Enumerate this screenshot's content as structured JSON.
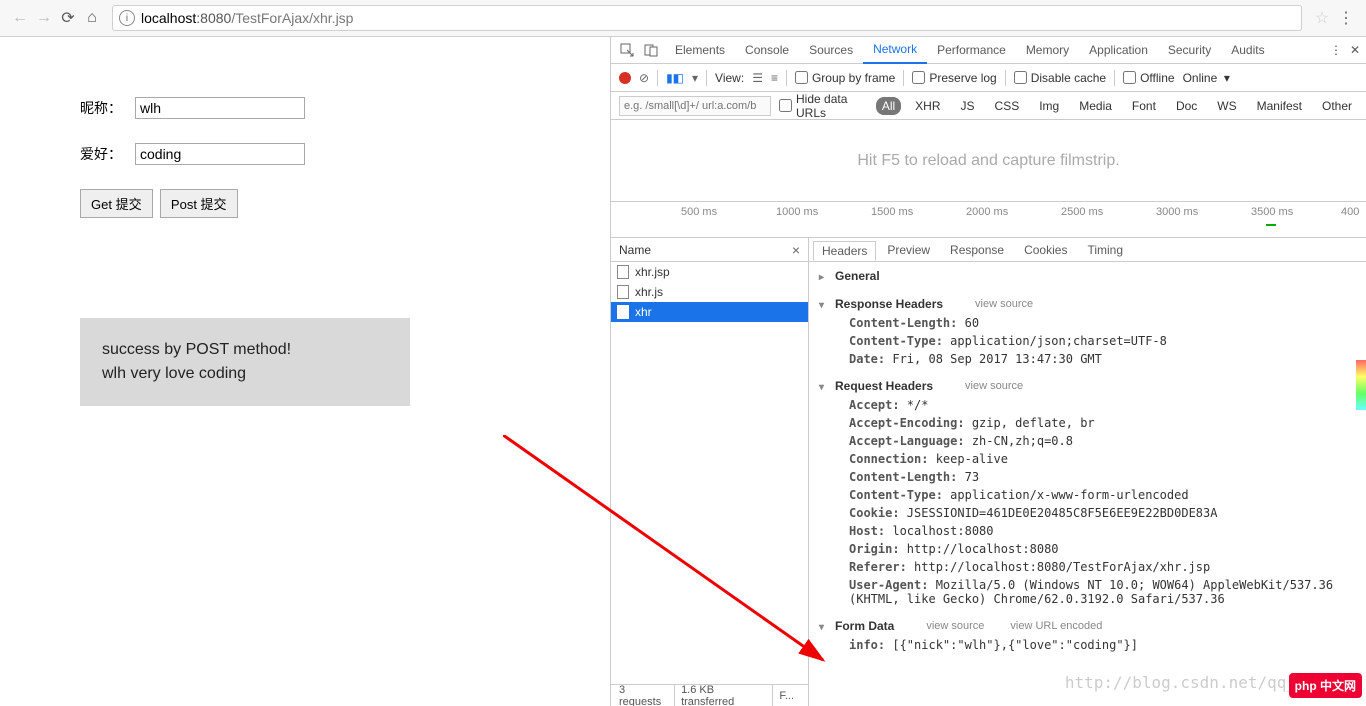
{
  "browser": {
    "url_host": "localhost",
    "url_port": ":8080",
    "url_path": "/TestForAjax/xhr.jsp"
  },
  "page": {
    "nick_label": "昵称：",
    "nick_value": "wlh",
    "hobby_label": "爱好：",
    "hobby_value": "coding",
    "get_btn": "Get 提交",
    "post_btn": "Post 提交",
    "result_line1": "success by POST method!",
    "result_line2": "wlh very love coding"
  },
  "devtools": {
    "tabs": [
      "Elements",
      "Console",
      "Sources",
      "Network",
      "Performance",
      "Memory",
      "Application",
      "Security",
      "Audits"
    ],
    "active_tab": "Network",
    "toolbar": {
      "view_label": "View:",
      "group_by_frame": "Group by frame",
      "preserve_log": "Preserve log",
      "disable_cache": "Disable cache",
      "offline": "Offline",
      "online": "Online"
    },
    "filter": {
      "placeholder": "e.g. /small[\\d]+/ url:a.com/b",
      "hide_data_urls": "Hide data URLs",
      "types": [
        "All",
        "XHR",
        "JS",
        "CSS",
        "Img",
        "Media",
        "Font",
        "Doc",
        "WS",
        "Manifest",
        "Other"
      ],
      "active_type": "All"
    },
    "filmstrip_hint": "Hit F5 to reload and capture filmstrip.",
    "timeline_ticks": [
      "500 ms",
      "1000 ms",
      "1500 ms",
      "2000 ms",
      "2500 ms",
      "3000 ms",
      "3500 ms",
      "400"
    ],
    "reqlist": {
      "header": "Name",
      "items": [
        "xhr.jsp",
        "xhr.js",
        "xhr"
      ],
      "selected": "xhr"
    },
    "details": {
      "tabs": [
        "Headers",
        "Preview",
        "Response",
        "Cookies",
        "Timing"
      ],
      "active": "Headers",
      "sections": {
        "general": "General",
        "response_headers": "Response Headers",
        "request_headers": "Request Headers",
        "form_data": "Form Data",
        "view_source": "view source",
        "view_url_encoded": "view URL encoded"
      },
      "response_headers": [
        {
          "k": "Content-Length:",
          "v": "60"
        },
        {
          "k": "Content-Type:",
          "v": "application/json;charset=UTF-8"
        },
        {
          "k": "Date:",
          "v": "Fri, 08 Sep 2017 13:47:30 GMT"
        }
      ],
      "request_headers": [
        {
          "k": "Accept:",
          "v": "*/*"
        },
        {
          "k": "Accept-Encoding:",
          "v": "gzip, deflate, br"
        },
        {
          "k": "Accept-Language:",
          "v": "zh-CN,zh;q=0.8"
        },
        {
          "k": "Connection:",
          "v": "keep-alive"
        },
        {
          "k": "Content-Length:",
          "v": "73"
        },
        {
          "k": "Content-Type:",
          "v": "application/x-www-form-urlencoded"
        },
        {
          "k": "Cookie:",
          "v": "JSESSIONID=461DE0E20485C8F5E6EE9E22BD0DE83A"
        },
        {
          "k": "Host:",
          "v": "localhost:8080"
        },
        {
          "k": "Origin:",
          "v": "http://localhost:8080"
        },
        {
          "k": "Referer:",
          "v": "http://localhost:8080/TestForAjax/xhr.jsp"
        },
        {
          "k": "User-Agent:",
          "v": "Mozilla/5.0 (Windows NT 10.0; WOW64) AppleWebKit/537.36 (KHTML, like Gecko) Chrome/62.0.3192.0 Safari/537.36"
        }
      ],
      "form_data": [
        {
          "k": "info:",
          "v": "[{\"nick\":\"wlh\"},{\"love\":\"coding\"}]"
        }
      ]
    },
    "status": {
      "requests": "3 requests",
      "transferred": "1.6 KB transferred",
      "finish": "F..."
    }
  },
  "watermark": "http://blog.csdn.net/qq_",
  "logo": "php 中文网"
}
